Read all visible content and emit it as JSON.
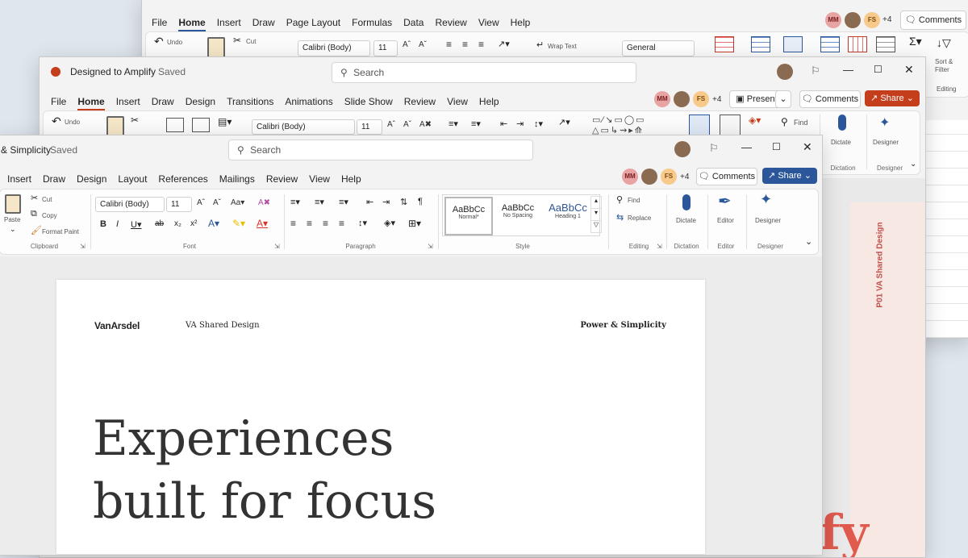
{
  "excel": {
    "menu": [
      "File",
      "Home",
      "Insert",
      "Draw",
      "Page Layout",
      "Formulas",
      "Data",
      "Review",
      "View",
      "Help"
    ],
    "undo": "Undo",
    "cut": "Cut",
    "font": "Calibri (Body)",
    "size": "11",
    "wrap_text": "Wrap Text",
    "number_format": "General",
    "comments": "Comments",
    "extra_people": "+4",
    "sort_filter": "Sort & Filter",
    "editing": "Editing"
  },
  "ppt": {
    "title": "Designed to Amplify",
    "saved": "Saved",
    "search": "Search",
    "menu": [
      "File",
      "Home",
      "Insert",
      "Draw",
      "Design",
      "Transitions",
      "Animations",
      "Slide Show",
      "Review",
      "View",
      "Help"
    ],
    "undo": "Undo",
    "font": "Calibri (Body)",
    "size": "11",
    "find": "Find",
    "dictate": "Dictate",
    "designer": "Designer",
    "dictation_group": "Dictation",
    "designer_group": "Designer",
    "present": "Present",
    "comments": "Comments",
    "share": "Share",
    "extra_people": "+4",
    "slide_side_text": "P01   VA Shared Design"
  },
  "word": {
    "title": "& Simplicity",
    "saved": "Saved",
    "search": "Search",
    "menu": [
      "Insert",
      "Draw",
      "Design",
      "Layout",
      "References",
      "Mailings",
      "Review",
      "View",
      "Help"
    ],
    "comments": "Comments",
    "share": "Share",
    "extra_people": "+4",
    "avatars": [
      "MM",
      "FS"
    ],
    "clipboard": {
      "paste": "Paste",
      "cut": "Cut",
      "copy": "Copy",
      "format_paint": "Format Paint",
      "label": "Clipboard"
    },
    "font": {
      "name": "Calibri (Body)",
      "size": "11",
      "label": "Font"
    },
    "paragraph_label": "Paragraph",
    "styles": [
      {
        "preview": "AaBbCc",
        "name": "Normal*"
      },
      {
        "preview": "AaBbCc",
        "name": "No Spacing"
      },
      {
        "preview": "AaBbCc",
        "name": "Heading 1"
      }
    ],
    "style_label": "Style",
    "find": "Find",
    "replace": "Replace",
    "editing_label": "Editing",
    "dictate": "Dictate",
    "dictation_label": "Dictation",
    "editor": "Editor",
    "editor_label": "Editor",
    "designer": "Designer",
    "designer_label": "Designer"
  },
  "document": {
    "logo": "VanArsdel",
    "header_center": "VA Shared Design",
    "header_right": "Power & Simplicity",
    "heading_line1": "Experiences",
    "heading_line2": "built for focus"
  },
  "colors": {
    "share_ppt": "#c43e1c",
    "share_word": "#2b579a",
    "mm": "#e8a3a3",
    "fs": "#f7c98a"
  }
}
